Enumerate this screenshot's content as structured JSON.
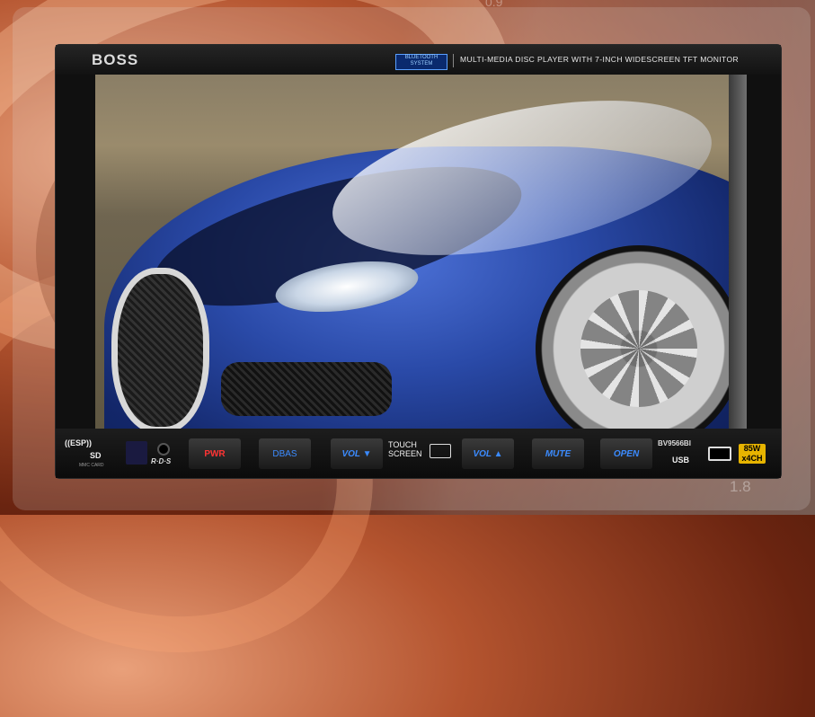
{
  "background": {
    "left_text": "0.9",
    "right_text": "1.8"
  },
  "unit": {
    "brand": "BOSS",
    "bluetooth_badge": "BLUETOOTH SYSTEM",
    "tagline": "MULTI-MEDIA DISC PLAYER WITH 7-INCH WIDESCREEN TFT MONITOR",
    "model": "BV9566BI",
    "power_badge": "85W x4CH"
  },
  "controls": {
    "esp": "((ESP))",
    "sd": "SD",
    "mmc": "MMC CARD",
    "rds": "R·D·S",
    "pwr": "PWR",
    "dbas": "DBAS",
    "vol_down": "VOL ▼",
    "touch_screen": "TOUCH SCREEN",
    "vol_up": "VOL ▲",
    "mute": "MUTE",
    "open": "OPEN",
    "usb": "USB"
  },
  "colors": {
    "accent_blue": "#3b8bff",
    "power_red": "#ff3434",
    "badge_gold": "#e7b400"
  }
}
